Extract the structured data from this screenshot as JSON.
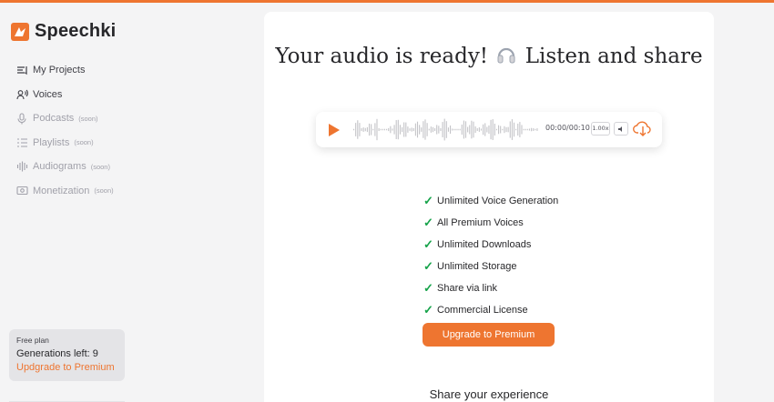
{
  "app": {
    "name": "Speechki",
    "accent_color": "#ee7530"
  },
  "sidebar": {
    "items": [
      {
        "label": "My Projects",
        "icon": "projects-icon",
        "soon": ""
      },
      {
        "label": "Voices",
        "icon": "voices-icon",
        "soon": ""
      },
      {
        "label": "Podcasts",
        "icon": "microphone-icon",
        "soon": "(soon)"
      },
      {
        "label": "Playlists",
        "icon": "playlist-icon",
        "soon": "(soon)"
      },
      {
        "label": "Audiograms",
        "icon": "waveform-icon",
        "soon": "(soon)"
      },
      {
        "label": "Monetization",
        "icon": "money-icon",
        "soon": "(soon)"
      }
    ],
    "plan": {
      "title": "Free plan",
      "generations": "Generations left: 9",
      "upgrade": "Updgrade to Premium"
    }
  },
  "main": {
    "headline_before": "Your audio is ready!",
    "headline_after": "Listen and share",
    "player": {
      "time": "00:00/00:10",
      "speed": "1.00x",
      "progress": 0
    },
    "features": [
      "Unlimited Voice Generation",
      "All Premium Voices",
      "Unlimited Downloads",
      "Unlimited Storage",
      "Share via link",
      "Commercial License"
    ],
    "upgrade_button": "Upgrade to Premium",
    "share_title": "Share your experience"
  }
}
